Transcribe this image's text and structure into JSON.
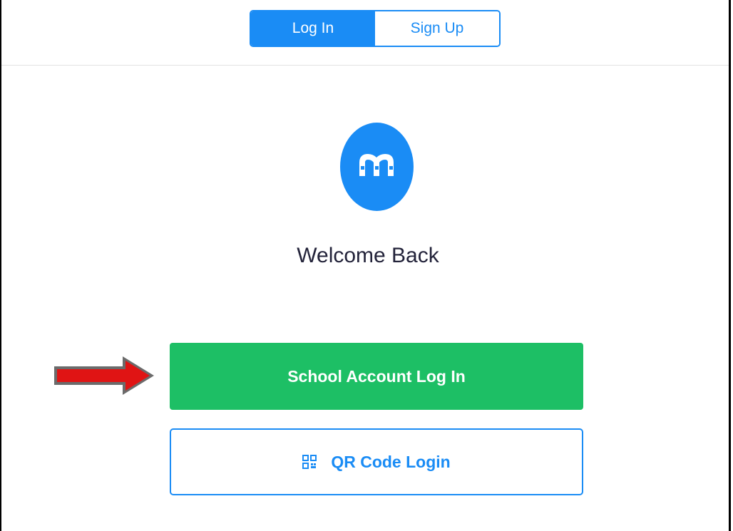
{
  "tabs": {
    "login_label": "Log In",
    "signup_label": "Sign Up"
  },
  "logo": {
    "icon": "m-logo-icon"
  },
  "welcome": {
    "title": "Welcome Back"
  },
  "buttons": {
    "school_login_label": "School Account Log In",
    "qr_login_label": "QR Code Login",
    "qr_icon": "qr-code-icon"
  },
  "annotation": {
    "arrow_icon": "right-arrow-icon"
  },
  "colors": {
    "primary_blue": "#1a8cf5",
    "green": "#1dbf65",
    "text_dark": "#23233a",
    "arrow_red": "#e01414"
  }
}
